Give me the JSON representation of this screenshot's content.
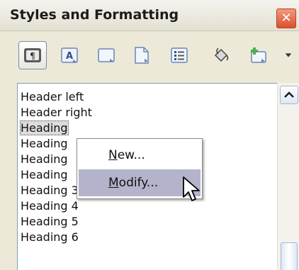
{
  "panel": {
    "title": "Styles and Formatting",
    "close_glyph": "✕"
  },
  "toolbar": {
    "buttons": [
      {
        "name": "paragraph-styles-icon",
        "active": true
      },
      {
        "name": "character-styles-icon"
      },
      {
        "name": "frame-styles-icon"
      },
      {
        "name": "page-styles-icon"
      },
      {
        "name": "list-styles-icon"
      },
      {
        "name": "fill-format-mode-icon"
      },
      {
        "name": "new-style-from-selection-icon"
      },
      {
        "name": "dropdown-arrow-icon"
      }
    ]
  },
  "styles_list": {
    "items": [
      "Header left",
      "Header right",
      "Heading",
      "Heading",
      "Heading",
      "Heading",
      "Heading 3",
      "Heading 4",
      "Heading 5",
      "Heading 6"
    ],
    "selected_index": 2
  },
  "context_menu": {
    "items": [
      {
        "mnemonic": "N",
        "rest": "ew..."
      },
      {
        "mnemonic": "M",
        "rest": "odify..."
      }
    ],
    "hovered_index": 1
  },
  "colors": {
    "menu_hover": "#b4b3cc",
    "close_button": "#d9502a",
    "panel_background": "#ece9d8"
  }
}
